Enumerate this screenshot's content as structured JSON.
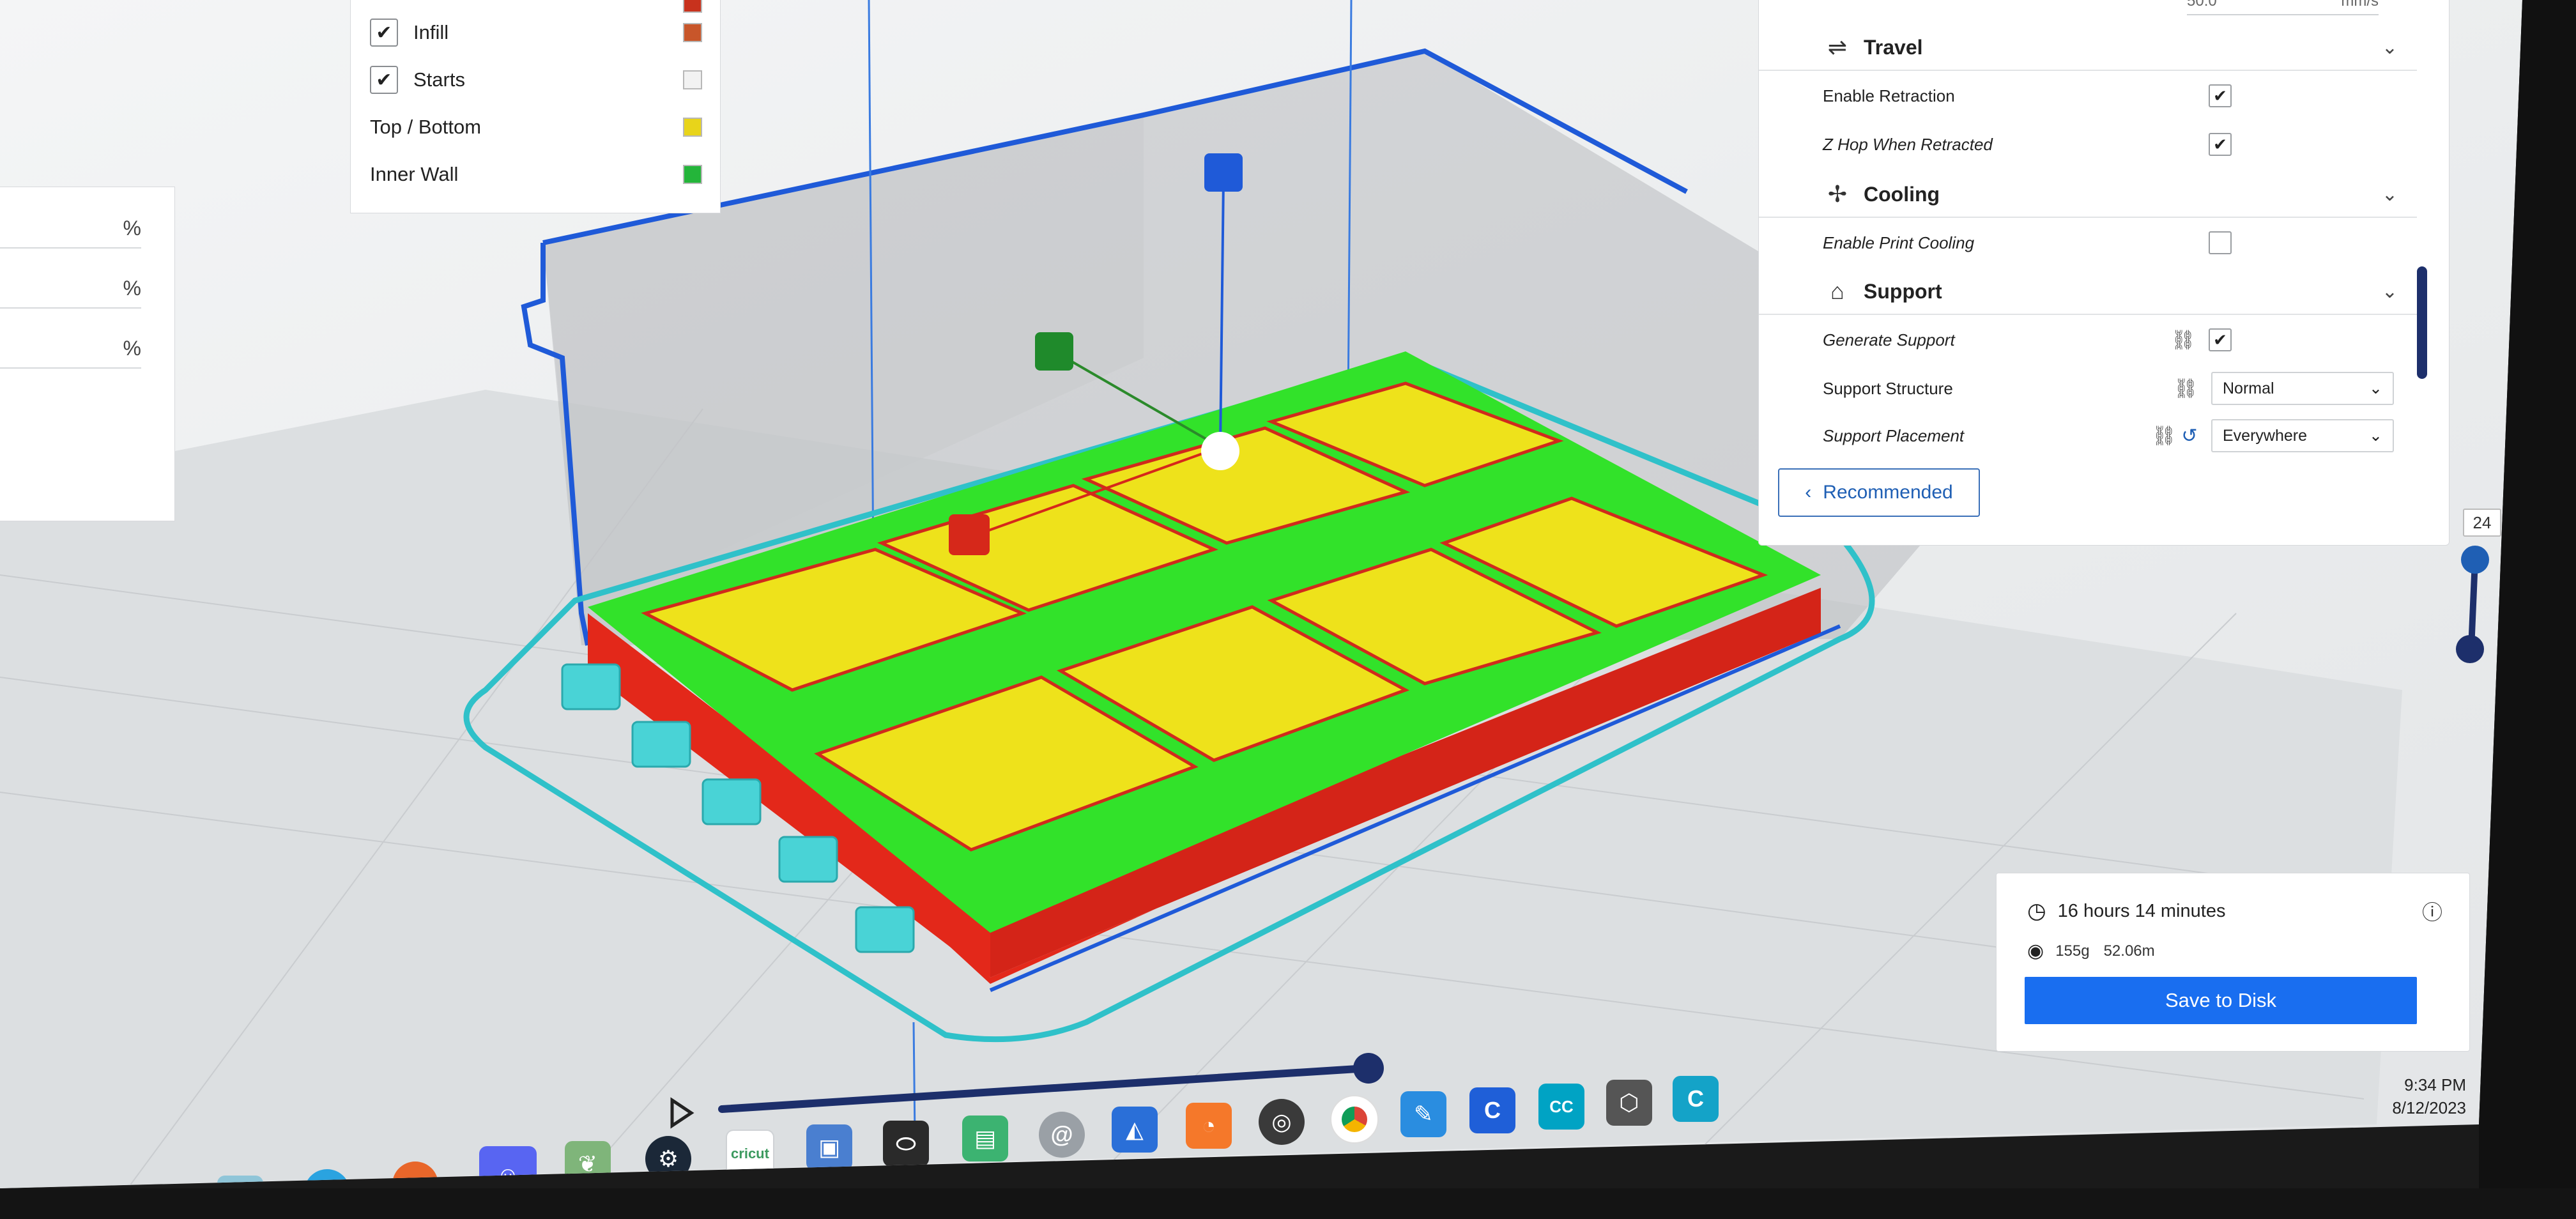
{
  "legend": {
    "items": [
      {
        "label": "Infill",
        "checked": true,
        "color": "#c8562a"
      },
      {
        "label": "Starts",
        "checked": true,
        "color": "#f2f2f2"
      },
      {
        "label": "Top / Bottom",
        "checked": false,
        "color": "#e8d41a"
      },
      {
        "label": "Inner Wall",
        "checked": false,
        "color": "#24b53a"
      }
    ],
    "check_glyph": "✔"
  },
  "left_panel": {
    "percent_unit": "%"
  },
  "settings": {
    "print_speed_value": "50.0",
    "print_speed_unit": "mm/s",
    "travel": {
      "title": "Travel",
      "icon": "travel-icon"
    },
    "enable_retraction": {
      "label": "Enable Retraction",
      "checked": true
    },
    "z_hop": {
      "label": "Z Hop When Retracted",
      "checked": true
    },
    "cooling": {
      "title": "Cooling",
      "icon": "fan-icon"
    },
    "enable_print_cooling": {
      "label": "Enable Print Cooling",
      "checked": false
    },
    "support": {
      "title": "Support",
      "icon": "support-icon"
    },
    "generate_support": {
      "label": "Generate Support",
      "checked": true
    },
    "support_structure": {
      "label": "Support Structure",
      "value": "Normal"
    },
    "support_placement": {
      "label": "Support Placement",
      "value": "Everywhere"
    },
    "recommended_button": "Recommended",
    "chevron": "⌄",
    "check_glyph": "✔"
  },
  "print_info": {
    "time": "16 hours 14 minutes",
    "weight": "155g",
    "length": "52.06m",
    "save_button": "Save to Disk"
  },
  "layer_slider": {
    "layer": "24",
    "accent": "#1f5fb4"
  },
  "clock": {
    "time": "9:34 PM",
    "date": "8/12/2023"
  },
  "taskbar": {
    "cricut_label": "cricut",
    "cc_label": "CC"
  }
}
